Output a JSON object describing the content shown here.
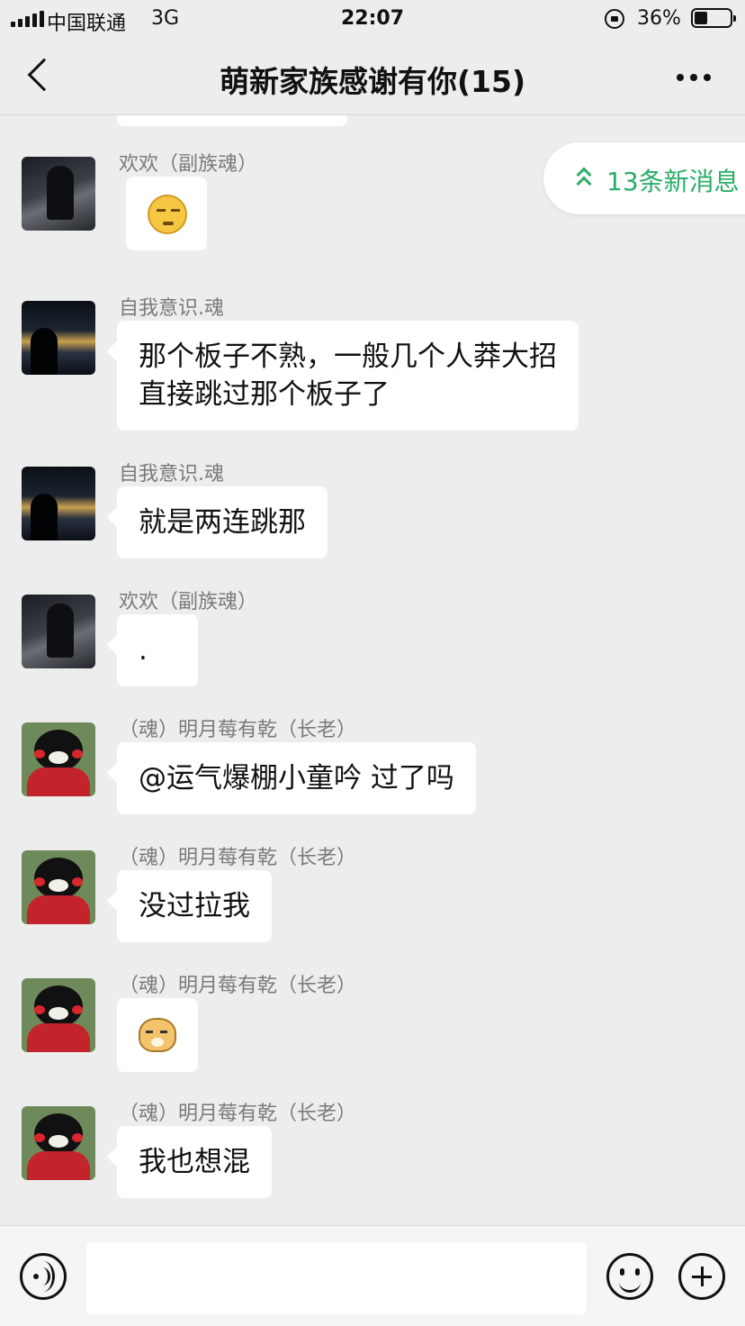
{
  "status_bar": {
    "carrier": "中国联通",
    "network": "3G",
    "time": "22:07",
    "battery_percent_text": "36%",
    "battery_level": 0.36
  },
  "nav": {
    "title": "萌新家族感谢有你(15)",
    "back_icon": "chevron-left-icon",
    "more_icon": "ellipsis-icon"
  },
  "new_messages": {
    "label": "13条新消息",
    "icon": "double-chevron-up-icon",
    "color": "#2aae67"
  },
  "messages": [
    {
      "sender": "欢欢（副族魂）",
      "type": "sticker",
      "sticker": "awkward-face-emoji"
    },
    {
      "sender": "自我意识.魂",
      "type": "text",
      "lines": [
        "那个板子不熟，一般几个人莽大招",
        "直接跳过那个板子了"
      ]
    },
    {
      "sender": "自我意识.魂",
      "type": "text",
      "lines": [
        "就是两连跳那"
      ]
    },
    {
      "sender": "欢欢（副族魂）",
      "type": "text",
      "lines": [
        "."
      ]
    },
    {
      "sender": "（魂）明月莓有乾（长老）",
      "type": "text",
      "lines": [
        "@运气爆棚小童吟 过了吗"
      ]
    },
    {
      "sender": "（魂）明月莓有乾（长老）",
      "type": "text",
      "lines": [
        "没过拉我"
      ]
    },
    {
      "sender": "（魂）明月莓有乾（长老）",
      "type": "sticker",
      "sticker": "doge-face-emoji"
    },
    {
      "sender": "（魂）明月莓有乾（长老）",
      "type": "text",
      "lines": [
        "我也想混"
      ]
    }
  ],
  "input_bar": {
    "voice_icon": "voice-icon",
    "input_value": "",
    "emoji_icon": "emoji-icon",
    "plus_icon": "plus-icon"
  },
  "colors": {
    "background": "#ededed",
    "bubble": "#ffffff",
    "accent": "#2aae67"
  }
}
